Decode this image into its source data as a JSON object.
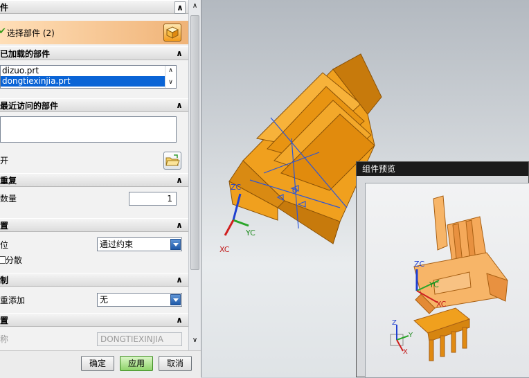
{
  "dialog": {
    "header_title": "件",
    "select_part_label": "选择部件 (2)",
    "loaded_parts": {
      "title": "已加载的部件",
      "items": [
        "dizuo.prt",
        "dongtiexinjia.prt"
      ],
      "selected_index": 1
    },
    "recent_parts": {
      "title": "最近访问的部件"
    },
    "open_label": "开",
    "repeat": {
      "title": "重复",
      "count_label": "数量",
      "count_value": "1"
    },
    "placement": {
      "title": "置",
      "position_label": "位",
      "position_value": "通过约束",
      "scatter_label": "分散"
    },
    "replicate": {
      "title": "制",
      "multi_add_label": "重添加",
      "multi_add_value": "无"
    },
    "settings": {
      "title": "置",
      "name_label": "称",
      "name_value": "DONGTIEXINJIA"
    },
    "buttons": {
      "ok": "确定",
      "apply": "应用",
      "cancel": "取消"
    }
  },
  "viewport": {
    "axes": {
      "x": "XC",
      "y": "YC",
      "z": "ZC"
    }
  },
  "preview": {
    "title": "组件预览",
    "axes": {
      "x": "XC",
      "y": "YC",
      "z": "ZC"
    },
    "mini_axes": {
      "x": "X",
      "y": "Y",
      "z": "Z"
    }
  },
  "colors": {
    "part_orange": "#f0a01e",
    "part_dark": "#c77a0c",
    "selection_blue": "#0a64d6",
    "select_row_bg": "#f3c28a"
  }
}
